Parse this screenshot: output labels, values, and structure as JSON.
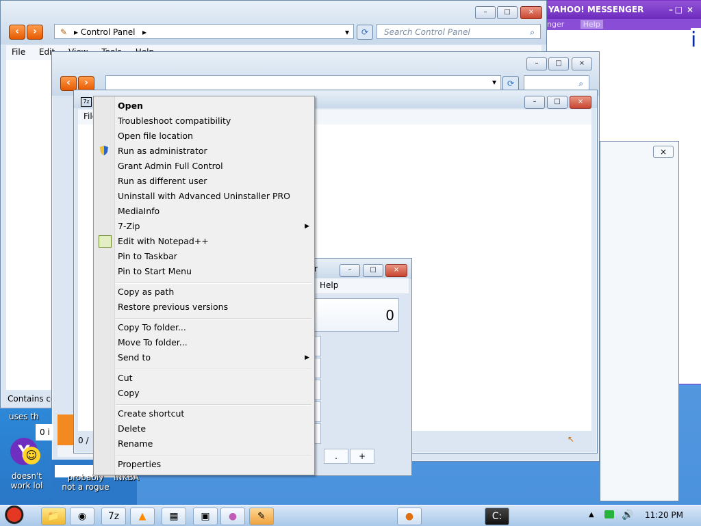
{
  "control_panel": {
    "breadcrumb": "Control Panel",
    "search_placeholder": "Search Control Panel",
    "menu": [
      "File",
      "Edit",
      "View",
      "Tools",
      "Help"
    ],
    "status": "Contains commands"
  },
  "messenger": {
    "title": "YAHOO! MESSENGER",
    "menu_help": "Help",
    "menu_partial": "nger"
  },
  "explorer_window": {
    "menu_file": "File",
    "status_partial": "0 /"
  },
  "calculator": {
    "title_partial": "r",
    "menu_help": "Help",
    "display": "0",
    "buttons_bottom": [
      ".",
      "+"
    ]
  },
  "context_menu": {
    "items": [
      {
        "label": "Open",
        "bold": true
      },
      {
        "label": "Troubleshoot compatibility"
      },
      {
        "label": "Open file location"
      },
      {
        "label": "Run as administrator",
        "icon": "shield-icon"
      },
      {
        "label": "Grant Admin Full Control"
      },
      {
        "label": "Run as different user"
      },
      {
        "label": "Uninstall with Advanced Uninstaller PRO"
      },
      {
        "label": "MediaInfo"
      },
      {
        "label": "7-Zip",
        "submenu": true
      },
      {
        "label": "Edit with Notepad++",
        "icon": "notepad-icon"
      },
      {
        "label": "Pin to Taskbar"
      },
      {
        "label": "Pin to Start Menu"
      },
      {
        "label": "Copy as path"
      },
      {
        "label": "Restore previous versions"
      },
      {
        "label": "Copy To folder..."
      },
      {
        "label": "Move To folder..."
      },
      {
        "label": "Send to",
        "submenu": true
      },
      {
        "label": "Cut"
      },
      {
        "label": "Copy"
      },
      {
        "label": "Create shortcut"
      },
      {
        "label": "Delete"
      },
      {
        "label": "Rename"
      },
      {
        "label": "Properties"
      }
    ]
  },
  "desktop": {
    "text_uses": "uses th",
    "text_zero": "0 i",
    "icons": [
      {
        "label_line1": "doesn't",
        "label_line2": "work lol"
      },
      {
        "label_line1": "probably",
        "label_line2": "not a rogue"
      },
      {
        "label_line1": "INKBA",
        "label_line2": ""
      }
    ]
  },
  "taskbar": {
    "time": "11:20 PM"
  },
  "colors": {
    "accent_orange": "#e65a00",
    "close_red": "#c84630",
    "messenger_purple": "#7a2fc9"
  }
}
